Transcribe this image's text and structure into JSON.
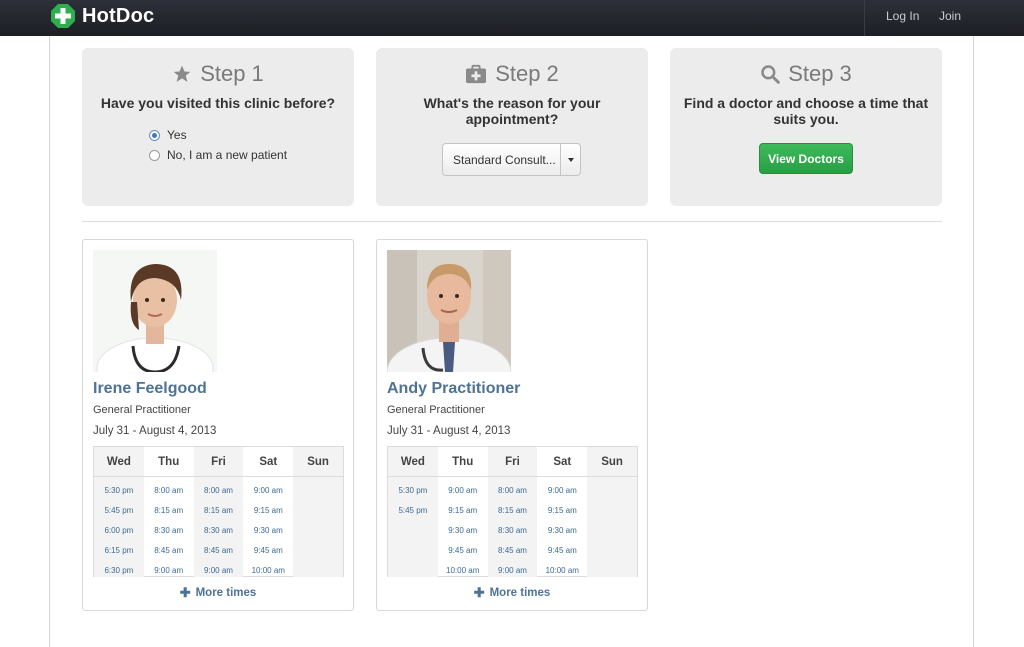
{
  "header": {
    "brand": "HotDoc",
    "login": "Log In",
    "join": "Join"
  },
  "steps": [
    {
      "title": "Step 1",
      "icon": "star-icon",
      "question": "Have you visited this clinic before?",
      "options": [
        {
          "label": "Yes",
          "selected": true
        },
        {
          "label": "No, I am a new patient",
          "selected": false
        }
      ]
    },
    {
      "title": "Step 2",
      "icon": "medical-kit-icon",
      "question": "What's the reason for your appointment?",
      "select_value": "Standard Consult..."
    },
    {
      "title": "Step 3",
      "icon": "search-icon",
      "question": "Find a doctor and choose a time that suits you.",
      "button": "View Doctors"
    }
  ],
  "doctors": [
    {
      "name": "Irene Feelgood",
      "role": "General Practitioner",
      "range": "July 31 - August 4, 2013",
      "days": [
        "Wed",
        "Thu",
        "Fri",
        "Sat",
        "Sun"
      ],
      "slots": [
        [
          "5:30 pm",
          "5:45 pm",
          "6:00 pm",
          "6:15 pm",
          "6:30 pm"
        ],
        [
          "8:00 am",
          "8:15 am",
          "8:30 am",
          "8:45 am",
          "9:00 am"
        ],
        [
          "8:00 am",
          "8:15 am",
          "8:30 am",
          "8:45 am",
          "9:00 am"
        ],
        [
          "9:00 am",
          "9:15 am",
          "9:30 am",
          "9:45 am",
          "10:00 am"
        ],
        []
      ],
      "more": "More times"
    },
    {
      "name": "Andy Practitioner",
      "role": "General Practitioner",
      "range": "July 31 - August 4, 2013",
      "days": [
        "Wed",
        "Thu",
        "Fri",
        "Sat",
        "Sun"
      ],
      "slots": [
        [
          "5:30 pm",
          "5:45 pm"
        ],
        [
          "9:00 am",
          "9:15 am",
          "9:30 am",
          "9:45 am",
          "10:00 am"
        ],
        [
          "8:00 am",
          "8:15 am",
          "8:30 am",
          "8:45 am",
          "9:00 am"
        ],
        [
          "9:00 am",
          "9:15 am",
          "9:30 am",
          "9:45 am",
          "10:00 am"
        ],
        []
      ],
      "more": "More times"
    }
  ],
  "colors": {
    "accent_green": "#2fae4e",
    "link_blue": "#4f7396",
    "topbar": "#23262d"
  }
}
